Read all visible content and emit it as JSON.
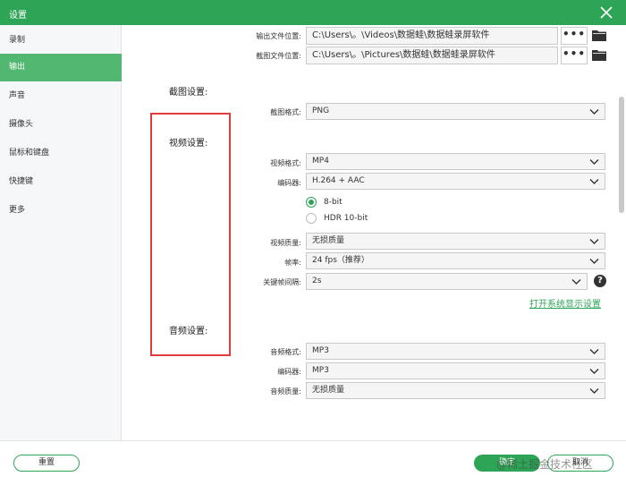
{
  "window": {
    "title": "设置"
  },
  "sidebar": {
    "items": [
      {
        "label": "录制"
      },
      {
        "label": "输出"
      },
      {
        "label": "声音"
      },
      {
        "label": "摄像头"
      },
      {
        "label": "鼠标和键盘"
      },
      {
        "label": "快捷键"
      },
      {
        "label": "更多"
      }
    ],
    "active_index": 1
  },
  "output": {
    "output_path_label": "输出文件位置:",
    "output_path_value": "C:\\Users\\。\\Videos\\数据蛙\\数据蛙录屏软件",
    "screenshot_path_label": "截图文件位置:",
    "screenshot_path_value": "C:\\Users\\。\\Pictures\\数据蛙\\数据蛙录屏软件",
    "browse_label": "•••"
  },
  "screenshot_settings": {
    "section_title": "截图设置:",
    "format_label": "截图格式:",
    "format_value": "PNG"
  },
  "video_settings": {
    "section_title": "视频设置:",
    "format_label": "视频格式:",
    "format_value": "MP4",
    "encoder_label": "编码器:",
    "encoder_value": "H.264 + AAC",
    "bitdepth_options": [
      "8-bit",
      "HDR 10-bit"
    ],
    "bitdepth_selected": "8-bit",
    "quality_label": "视频质量:",
    "quality_value": "无损质量",
    "framerate_label": "帧率:",
    "framerate_value": "24 fps（推荐）",
    "keyframe_label": "关键帧间隔:",
    "keyframe_value": "2s",
    "help_label": "?",
    "display_settings_link": "打开系统显示设置"
  },
  "audio_settings": {
    "section_title": "音频设置:",
    "format_label": "音频格式:",
    "format_value": "MP3",
    "encoder_label": "编码器:",
    "encoder_value": "MP3",
    "quality_label": "音频质量:",
    "quality_value": "无损质量"
  },
  "footer": {
    "reset_label": "重置",
    "confirm_label": "确定",
    "cancel_label": "取消",
    "watermark": "@稀土掘金技术社区"
  },
  "colors": {
    "brand_green": "#2ea456",
    "sidebar_active": "#52b871",
    "annotation_red": "#e23b3b"
  }
}
